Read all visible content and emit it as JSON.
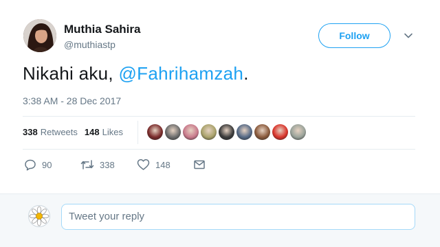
{
  "author": {
    "name": "Muthia Sahira",
    "handle": "@muthiastp"
  },
  "follow_label": "Follow",
  "tweet": {
    "text": "Nikahi aku, ",
    "mention": "@Fahrihamzah",
    "text_end": ".",
    "timestamp": "3:38 AM - 28 Dec 2017"
  },
  "stats": {
    "retweets_count": "338",
    "retweets_label": "Retweets",
    "likes_count": "148",
    "likes_label": "Likes"
  },
  "retweeter_avatars": [
    {
      "icon": "avatar-thumb",
      "color": "#7a2b2b"
    },
    {
      "icon": "avatar-thumb",
      "color": "#6d6d6d"
    },
    {
      "icon": "avatar-thumb",
      "color": "#c97a8c"
    },
    {
      "icon": "avatar-thumb",
      "color": "#a9a26b"
    },
    {
      "icon": "avatar-thumb",
      "color": "#3b3b3b"
    },
    {
      "icon": "avatar-thumb",
      "color": "#566a86"
    },
    {
      "icon": "avatar-thumb",
      "color": "#8a5a3c"
    },
    {
      "icon": "avatar-thumb",
      "color": "#d9342b"
    },
    {
      "icon": "avatar-thumb",
      "color": "#9aa39a"
    }
  ],
  "actions": {
    "reply_count": "90",
    "retweet_count": "338",
    "like_count": "148"
  },
  "reply_box": {
    "placeholder": "Tweet your reply"
  },
  "colors": {
    "accent": "#1da1f2",
    "secondary_text": "#657786"
  }
}
